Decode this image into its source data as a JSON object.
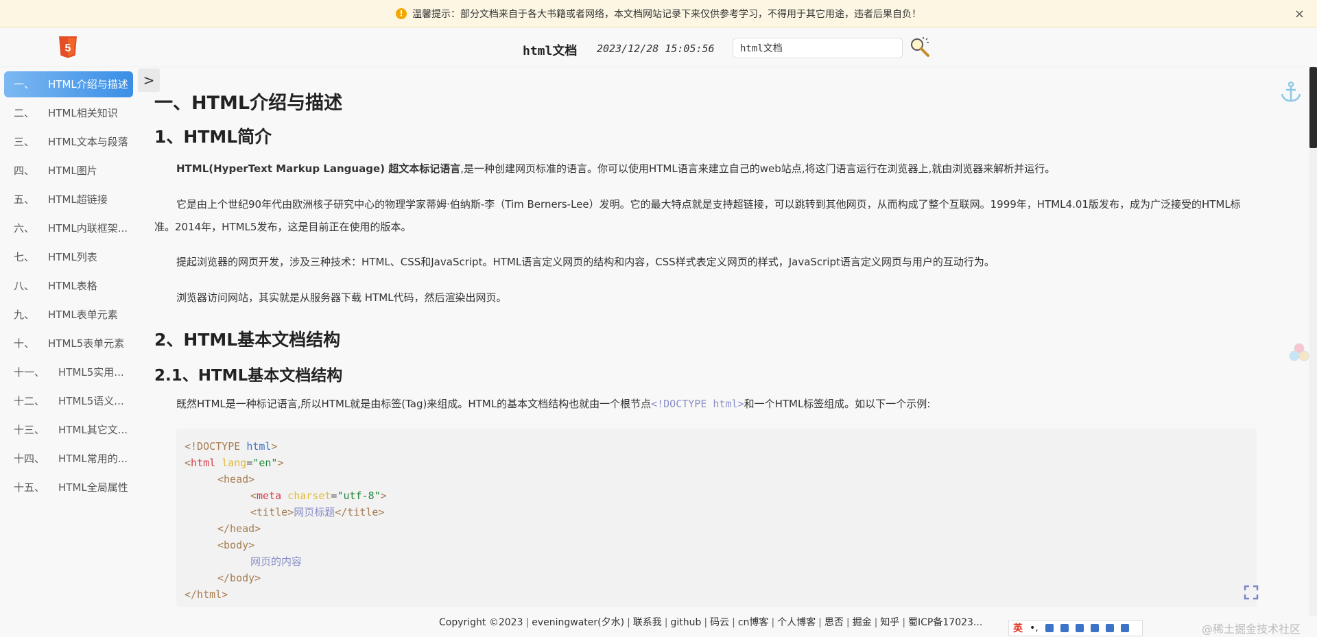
{
  "notice": {
    "text": "温馨提示：部分文档来自于各大书籍或者网络，本文档网站记录下来仅供参考学习，不得用于其它用途，违者后果自负！",
    "warn_symbol": "!",
    "close_symbol": "×",
    "icon": "warning-icon"
  },
  "header": {
    "logo": "html5-logo",
    "title": "html文档",
    "datetime": "2023/12/28 15:05:56",
    "search_value": "html文档",
    "search_icon": "magnifier-icon"
  },
  "sidebar": {
    "toggle_symbol": ">",
    "items": [
      {
        "num": "一、",
        "label": "HTML介绍与描述"
      },
      {
        "num": "二、",
        "label": "HTML相关知识"
      },
      {
        "num": "三、",
        "label": "HTML文本与段落"
      },
      {
        "num": "四、",
        "label": "HTML图片"
      },
      {
        "num": "五、",
        "label": "HTML超链接"
      },
      {
        "num": "六、",
        "label": "HTML内联框架..."
      },
      {
        "num": "七、",
        "label": "HTML列表"
      },
      {
        "num": "八、",
        "label": "HTML表格"
      },
      {
        "num": "九、",
        "label": "HTML表单元素"
      },
      {
        "num": "十、",
        "label": "HTML5表单元素"
      },
      {
        "num": "十一、",
        "label": "HTML5实用..."
      },
      {
        "num": "十二、",
        "label": "HTML5语义..."
      },
      {
        "num": "十三、",
        "label": "HTML其它文..."
      },
      {
        "num": "十四、",
        "label": "HTML常用的..."
      },
      {
        "num": "十五、",
        "label": "HTML全局属性"
      }
    ]
  },
  "content": {
    "h1": "一、HTML介绍与描述",
    "h2_intro": "1、HTML简介",
    "p1_bold": "HTML(HyperText Markup Language) 超文本标记语言",
    "p1_rest": ",是一种创建网页标准的语言。你可以使用HTML语言来建立自己的web站点,将这门语言运行在浏览器上,就由浏览器来解析并运行。",
    "p2": "它是由上个世纪90年代由欧洲核子研究中心的物理学家蒂姆·伯纳斯-李（Tim Berners-Lee）发明。它的最大特点就是支持超链接，可以跳转到其他网页，从而构成了整个互联网。1999年，HTML4.01版发布，成为广泛接受的HTML标准。2014年，HTML5发布，这是目前正在使用的版本。",
    "p3": "提起浏览器的网页开发，涉及三种技术：HTML、CSS和JavaScript。HTML语言定义网页的结构和内容，CSS样式表定义网页的样式，JavaScript语言定义网页与用户的互动行为。",
    "p4": "浏览器访问网站，其实就是从服务器下载 HTML代码，然后渲染出网页。",
    "h2_structure": "2、HTML基本文档结构",
    "h3_structure": "2.1、HTML基本文档结构",
    "p5_pre": "既然HTML是一种标记语言,所以HTML就是由标签(Tag)来组成。HTML的基本文档结构也就由一个根节点",
    "p5_code": "<!DOCTYPE html>",
    "p5_post": "和一个HTML标签组成。如以下一个示例:",
    "code": {
      "l1_a": "<!DOCTYPE ",
      "l1_b": "html",
      "l1_c": ">",
      "l2_a": "<",
      "l2_tag": "html",
      "l2_attr": " lang",
      "l2_eq": "=",
      "l2_val": "\"en\"",
      "l2_end": ">",
      "l3": "<head>",
      "l4_a": "<",
      "l4_tag": "meta",
      "l4_attr": " charset",
      "l4_eq": "=",
      "l4_val": "\"utf-8\"",
      "l4_end": ">",
      "l5_a": "<title>",
      "l5_text": "网页标题",
      "l5_b": "</title>",
      "l6": "</head>",
      "l7": "<body>",
      "l8": "网页的内容",
      "l9": "</body>",
      "l10": "</html>"
    }
  },
  "footer": {
    "copyright": "Copyright ©2023",
    "links": [
      "eveningwater(夕水)",
      "联系我",
      "github",
      "码云",
      "cn博客",
      "个人博客",
      "思否",
      "掘金",
      "知乎",
      "蜀ICP备17023..."
    ],
    "separator": "|"
  },
  "ime": {
    "label": "英",
    "punct": "•,"
  },
  "watermark": "@稀土掘金技术社区",
  "colors": {
    "accent": "#3a8ee6",
    "notice_bg": "#fdf6e3",
    "code_bg": "#f2f2f2"
  }
}
